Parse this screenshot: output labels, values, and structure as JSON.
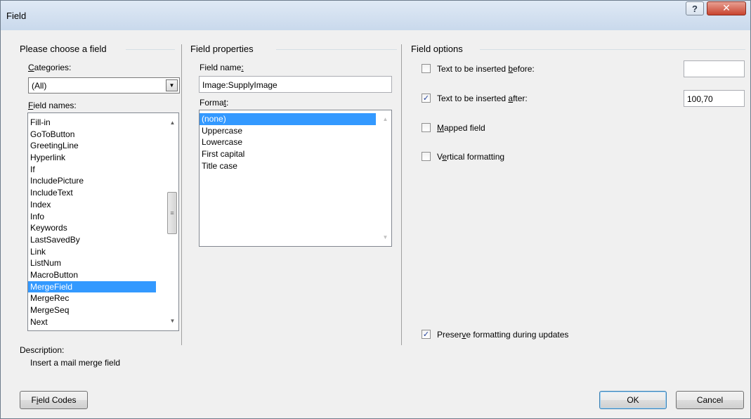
{
  "window": {
    "title": "Field"
  },
  "titlebar": {
    "help_glyph": "?",
    "close_glyph": "✕"
  },
  "left": {
    "group_title": "Please choose a field",
    "categories_label_hot": "C",
    "categories_label_rest": "ategories:",
    "categories_value": "(All)",
    "field_names_label_hot": "F",
    "field_names_label_rest": "ield names:",
    "field_names": [
      "Fill-in",
      "GoToButton",
      "GreetingLine",
      "Hyperlink",
      "If",
      "IncludePicture",
      "IncludeText",
      "Index",
      "Info",
      "Keywords",
      "LastSavedBy",
      "Link",
      "ListNum",
      "MacroButton",
      "MergeField",
      "MergeRec",
      "MergeSeq",
      "Next"
    ],
    "selected_field": "MergeField",
    "description_label": "Description:",
    "description_text": "Insert a mail merge field"
  },
  "middle": {
    "group_title": "Field properties",
    "field_name_label_rest": "Field name",
    "field_name_label_hot": ":",
    "field_name_value": "Image:SupplyImage",
    "format_label_rest": "Forma",
    "format_label_hot": "t",
    "format_label_tail": ":",
    "formats": [
      "(none)",
      "Uppercase",
      "Lowercase",
      "First capital",
      "Title case"
    ],
    "selected_format": "(none)"
  },
  "right": {
    "group_title": "Field options",
    "opt_before": {
      "pre": "Text to be inserted ",
      "hot": "b",
      "post": "efore:",
      "checked": false,
      "value": ""
    },
    "opt_after": {
      "pre": "Text to be inserted ",
      "hot": "a",
      "post": "fter:",
      "checked": true,
      "value": "100,70"
    },
    "opt_mapped": {
      "pre": "",
      "hot": "M",
      "post": "apped field",
      "checked": false
    },
    "opt_vertical": {
      "pre": "V",
      "hot": "e",
      "post": "rtical formatting",
      "checked": false
    },
    "opt_preserve": {
      "pre": "Preser",
      "hot": "v",
      "post": "e formatting during updates",
      "checked": true
    }
  },
  "buttons": {
    "field_codes_hot": "i",
    "field_codes_pre": "F",
    "field_codes_post": "eld Codes",
    "ok": "OK",
    "cancel": "Cancel"
  },
  "colors": {
    "selection": "#3399ff",
    "dialog_bg": "#f0f0f0",
    "close_red": "#c9442f"
  }
}
